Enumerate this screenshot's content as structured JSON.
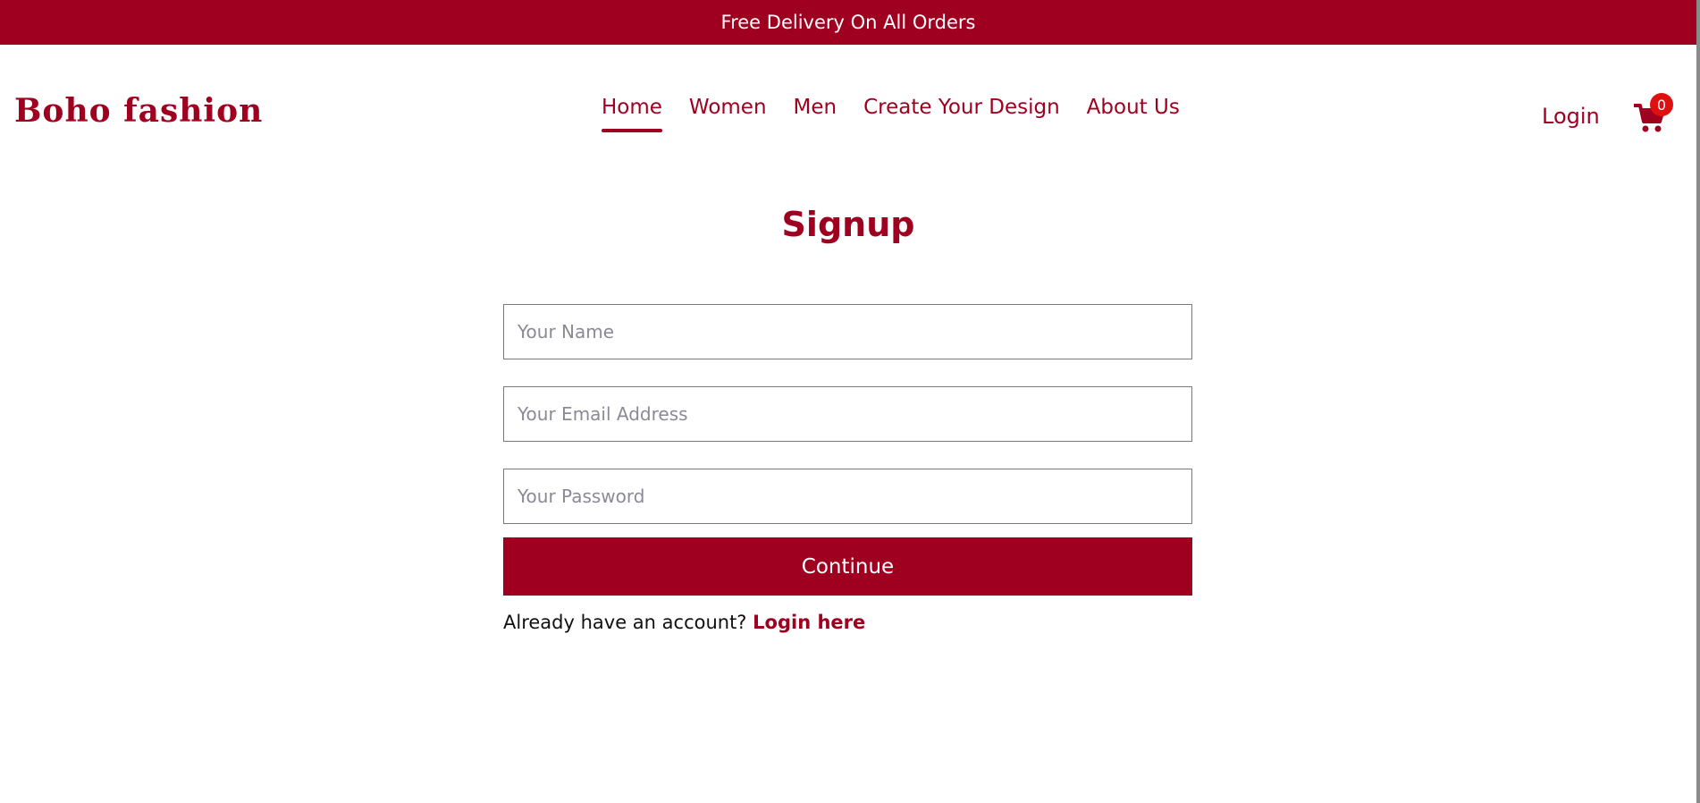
{
  "banner": {
    "text": "Free Delivery On All Orders"
  },
  "brand": {
    "name": "Boho fashion"
  },
  "nav": {
    "items": [
      {
        "label": "Home",
        "active": true
      },
      {
        "label": "Women",
        "active": false
      },
      {
        "label": "Men",
        "active": false
      },
      {
        "label": "Create Your Design",
        "active": false
      },
      {
        "label": "About Us",
        "active": false
      }
    ]
  },
  "header": {
    "login_label": "Login",
    "cart_count": "0",
    "cart_icon": "shopping-cart-icon"
  },
  "signup": {
    "title": "Signup",
    "name_placeholder": "Your Name",
    "email_placeholder": "Your Email Address",
    "password_placeholder": "Your Password",
    "continue_label": "Continue",
    "already_text": "Already have an account?",
    "login_here_label": "Login here"
  },
  "colors": {
    "brand": "#a00020",
    "badge": "#e01010"
  }
}
